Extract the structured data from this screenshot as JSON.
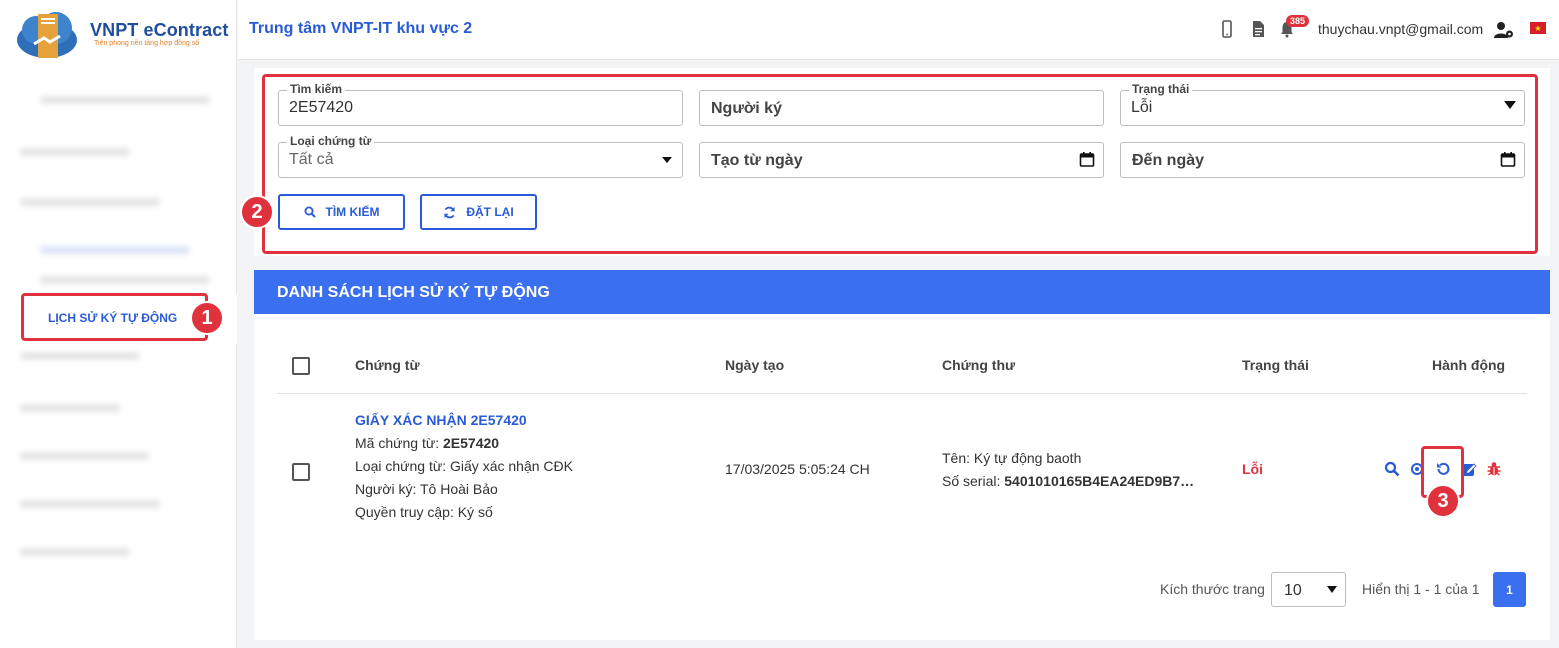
{
  "app": {
    "logo_title": "VNPT eContract",
    "logo_tagline": "Tiên phong nền tảng hợp đồng số"
  },
  "sidebar": {
    "active_item": "LỊCH SỬ KÝ TỰ ĐỘNG"
  },
  "header": {
    "title": "Trung tâm VNPT-IT khu vực 2",
    "notification_count": "385",
    "user_email": "thuychau.vnpt@gmail.com",
    "icons": [
      "mobile-icon",
      "document-icon",
      "bell-icon",
      "user-settings-icon",
      "vietnam-flag-icon"
    ]
  },
  "filters": {
    "search": {
      "label": "Tìm kiếm",
      "value": "2E57420"
    },
    "signer": {
      "placeholder": "Người ký"
    },
    "status": {
      "label": "Trạng thái",
      "value": "Lỗi"
    },
    "doc_type": {
      "label": "Loại chứng từ",
      "value": "Tất cả"
    },
    "from_date": {
      "placeholder": "Tạo từ ngày"
    },
    "to_date": {
      "placeholder": "Đến ngày"
    },
    "search_button": "TÌM KIẾM",
    "reset_button": "ĐẶT LẠI"
  },
  "list": {
    "title": "DANH SÁCH LỊCH SỬ KÝ TỰ ĐỘNG",
    "columns": [
      "Chứng từ",
      "Ngày tạo",
      "Chứng thư",
      "Trạng thái",
      "Hành động"
    ],
    "rows": [
      {
        "doc_title": "GIẤY XÁC NHẬN 2E57420",
        "code_label": "Mã chứng từ: ",
        "code_value": "2E57420",
        "type_line": "Loại chứng từ: Giấy xác nhận CĐK",
        "signer_line": "Người ký: Tô Hoài Bảo",
        "access_line": "Quyền truy cập: Ký số",
        "created": "17/03/2025 5:05:24 CH",
        "cert_name": "Tên: Ký tự động baoth",
        "serial_label": "Số serial: ",
        "serial_value": "5401010165B4EA24ED9B7…",
        "status": "Lỗi",
        "actions": [
          "search-icon",
          "eye-icon",
          "retry-icon",
          "edit-icon",
          "bug-icon"
        ]
      }
    ]
  },
  "pagination": {
    "page_size_label": "Kích thước trang",
    "page_size": "10",
    "showing": "Hiển thị 1 - 1 của 1",
    "current_page": "1"
  },
  "callouts": [
    "1",
    "2",
    "3"
  ],
  "colors": {
    "primary": "#2a5bd7",
    "header_bar": "#3a6ff0",
    "callout": "#e0323c",
    "error": "#e0323c"
  }
}
